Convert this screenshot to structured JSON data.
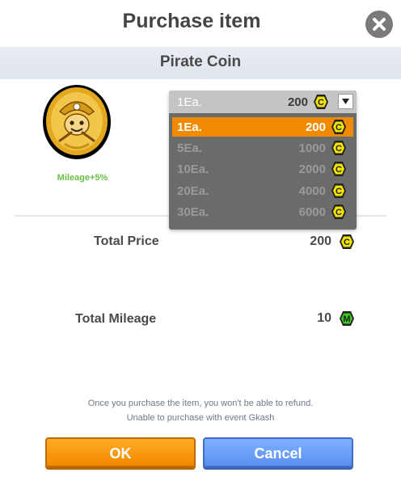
{
  "dialog": {
    "title": "Purchase item",
    "item_name": "Pirate Coin",
    "mileage_bonus": "Mileage+5%"
  },
  "quantity_select": {
    "selected_qty": "1Ea.",
    "selected_price": "200",
    "options": [
      {
        "qty": "1Ea.",
        "price": "200",
        "selected": true
      },
      {
        "qty": "5Ea.",
        "price": "1000",
        "selected": false
      },
      {
        "qty": "10Ea.",
        "price": "2000",
        "selected": false
      },
      {
        "qty": "20Ea.",
        "price": "4000",
        "selected": false
      },
      {
        "qty": "30Ea.",
        "price": "6000",
        "selected": false
      }
    ]
  },
  "summary": {
    "total_price_label": "Total Price",
    "total_price_value": "200",
    "total_mileage_label": "Total Mileage",
    "total_mileage_value": "10"
  },
  "currency": {
    "coin_letter": "C",
    "mileage_letter": "M"
  },
  "notices": [
    "Once you purchase the item, you won't be able to refund.",
    "Unable to purchase with event Gkash"
  ],
  "buttons": {
    "ok_label": "OK",
    "cancel_label": "Cancel"
  },
  "colors": {
    "accent_orange": "#f08a00",
    "accent_blue": "#5a90f2",
    "coin_badge": "#f2e300",
    "mileage_badge": "#3cc81e"
  }
}
